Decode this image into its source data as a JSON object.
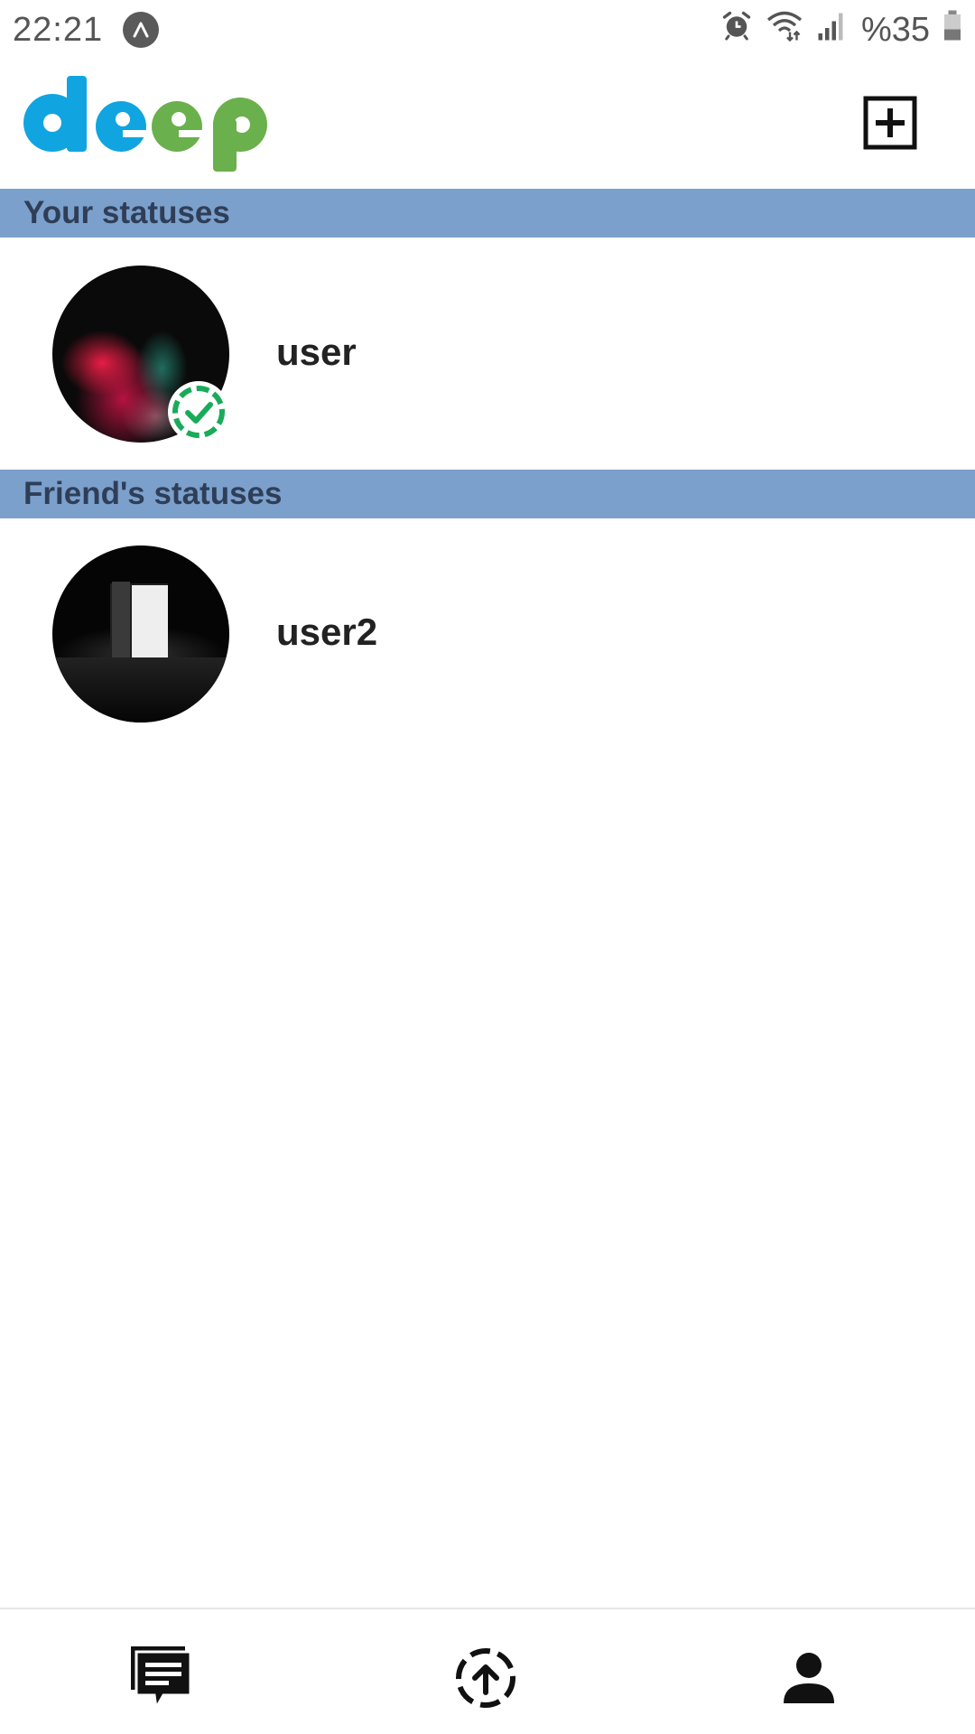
{
  "status_bar": {
    "time": "22:21",
    "battery_text": "%35",
    "icons": [
      "app-notification-icon",
      "alarm-icon",
      "wifi-icon",
      "signal-icon",
      "battery-icon"
    ]
  },
  "header": {
    "logo_text": "deep",
    "logo_colors": [
      "#10a5e0",
      "#10a5e0",
      "#6ab04c",
      "#6ab04c"
    ],
    "add_button_icon": "add-box-icon"
  },
  "sections": {
    "your_statuses": "Your statuses",
    "friends_statuses": "Friend's statuses"
  },
  "statuses": {
    "mine": {
      "name": "user",
      "avatar": "red-powder-explosion-image",
      "badge_icon": "seen-check-icon"
    },
    "friends": [
      {
        "name": "user2",
        "avatar": "open-door-light-image"
      }
    ]
  },
  "bottom_nav": {
    "items": [
      {
        "icon": "chats-icon"
      },
      {
        "icon": "status-upload-icon"
      },
      {
        "icon": "profile-icon"
      }
    ]
  },
  "colors": {
    "section_header_bg": "#7ba0cc",
    "section_header_text": "#2f3e57",
    "badge_green": "#1aab5a"
  }
}
